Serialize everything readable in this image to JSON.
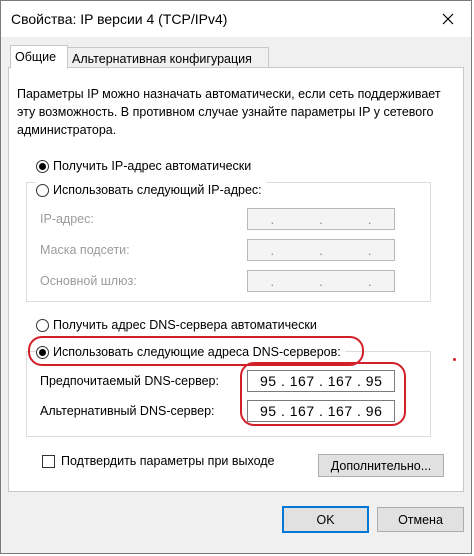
{
  "window": {
    "title": "Свойства: IP версии 4 (TCP/IPv4)",
    "close_icon": "close-icon"
  },
  "tabs": [
    {
      "label": "Общие",
      "active": true
    },
    {
      "label": "Альтернативная конфигурация",
      "active": false
    }
  ],
  "description": "Параметры IP можно назначать автоматически, если сеть поддерживает эту возможность. В противном случае узнайте параметры IP у сетевого администратора.",
  "ip": {
    "auto_label": "Получить IP-адрес автоматически",
    "manual_label": "Использовать следующий IP-адрес:",
    "auto_selected": true,
    "fields": [
      {
        "label": "IP-адрес:",
        "value": ". . ."
      },
      {
        "label": "Маска подсети:",
        "value": ". . ."
      },
      {
        "label": "Основной шлюз:",
        "value": ". . ."
      }
    ]
  },
  "dns": {
    "auto_label": "Получить адрес DNS-сервера автоматически",
    "manual_label": "Использовать следующие адреса DNS-серверов:",
    "manual_selected": true,
    "preferred_label": "Предпочитаемый DNS-сервер:",
    "preferred_value": "95 . 167 . 167 . 95",
    "alternate_label": "Альтернативный DNS-сервер:",
    "alternate_value": "95 . 167 . 167 . 96"
  },
  "validate": {
    "label": "Подтвердить параметры при выходе",
    "checked": false
  },
  "buttons": {
    "advanced": "Дополнительно...",
    "ok": "OK",
    "cancel": "Отмена"
  },
  "colors": {
    "highlight": "#d2202a",
    "focus": "#0078d7"
  }
}
